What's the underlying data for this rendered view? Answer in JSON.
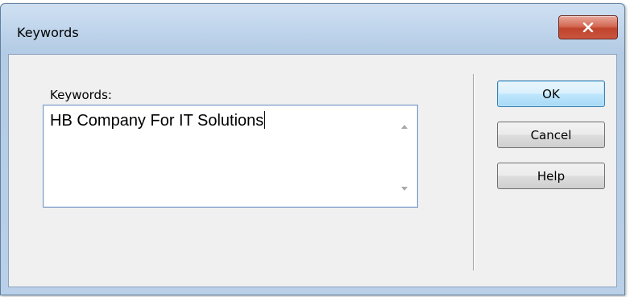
{
  "window": {
    "title": "Keywords",
    "close_label": "X"
  },
  "form": {
    "keywords_label": "Keywords:",
    "keywords_value": "HB Company For IT Solutions"
  },
  "buttons": {
    "ok": "OK",
    "cancel": "Cancel",
    "help": "Help"
  },
  "icons": {
    "close": "close-icon",
    "scroll_up": "scroll-up-arrow-icon",
    "scroll_down": "scroll-down-arrow-icon"
  },
  "colors": {
    "close_button": "#c8553f",
    "frame": "#b9d0e8",
    "default_button": "#bee6fd"
  }
}
